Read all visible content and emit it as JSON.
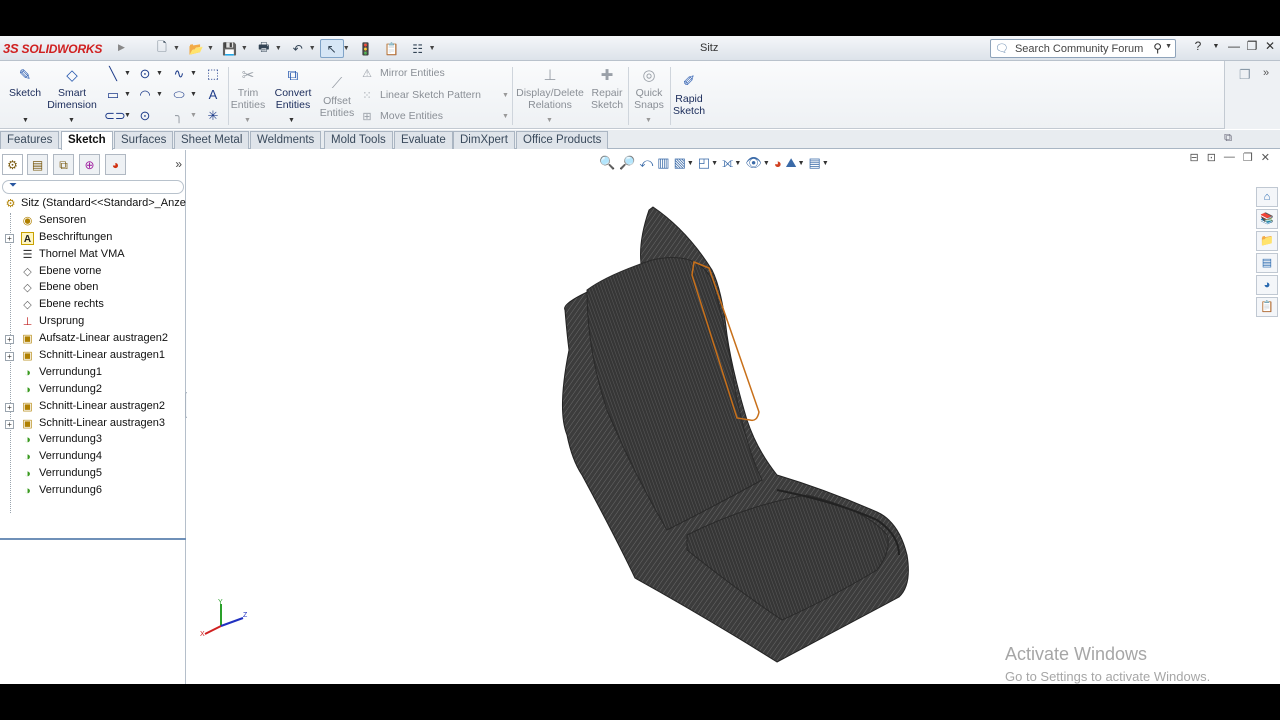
{
  "app": {
    "brand_prefix": "3S",
    "brand": "SOLIDWORKS",
    "document_title": "Sitz"
  },
  "search": {
    "placeholder": "Search Community Forum"
  },
  "commands": {
    "sketch": "Sketch",
    "smart_dimension": "Smart Dimension",
    "trim_entities": "Trim Entities",
    "convert_entities": "Convert Entities",
    "offset_entities": "Offset Entities",
    "mirror_entities": "Mirror Entities",
    "linear_sketch_pattern": "Linear Sketch Pattern",
    "move_entities": "Move Entities",
    "display_delete_relations": "Display/Delete Relations",
    "repair_sketch": "Repair Sketch",
    "quick_snaps": "Quick Snaps",
    "rapid_sketch": "Rapid Sketch"
  },
  "tabs": [
    {
      "label": "Features"
    },
    {
      "label": "Sketch",
      "active": true
    },
    {
      "label": "Surfaces"
    },
    {
      "label": "Sheet Metal"
    },
    {
      "label": "Weldments"
    },
    {
      "label": "Mold Tools"
    },
    {
      "label": "Evaluate"
    },
    {
      "label": "DimXpert"
    },
    {
      "label": "Office Products"
    }
  ],
  "tree": {
    "root": "Sitz  (Standard<<Standard>_Anze",
    "items": [
      {
        "label": "Sensoren",
        "icon": "sensor-icon",
        "expand": false
      },
      {
        "label": "Beschriftungen",
        "icon": "annotations-icon",
        "expand": true
      },
      {
        "label": "Thornel Mat VMA",
        "icon": "material-icon",
        "expand": false
      },
      {
        "label": "Ebene vorne",
        "icon": "plane-icon",
        "expand": false
      },
      {
        "label": "Ebene oben",
        "icon": "plane-icon",
        "expand": false
      },
      {
        "label": "Ebene rechts",
        "icon": "plane-icon",
        "expand": false
      },
      {
        "label": "Ursprung",
        "icon": "origin-icon",
        "expand": false
      },
      {
        "label": "Aufsatz-Linear austragen2",
        "icon": "extrude-boss-icon",
        "expand": true
      },
      {
        "label": "Schnitt-Linear austragen1",
        "icon": "extrude-cut-icon",
        "expand": true
      },
      {
        "label": "Verrundung1",
        "icon": "fillet-icon",
        "expand": false
      },
      {
        "label": "Verrundung2",
        "icon": "fillet-icon",
        "expand": false
      },
      {
        "label": "Schnitt-Linear austragen2",
        "icon": "extrude-cut-icon",
        "expand": true
      },
      {
        "label": "Schnitt-Linear austragen3",
        "icon": "extrude-cut-icon",
        "expand": true
      },
      {
        "label": "Verrundung3",
        "icon": "fillet-icon",
        "expand": false
      },
      {
        "label": "Verrundung4",
        "icon": "fillet-icon",
        "expand": false
      },
      {
        "label": "Verrundung5",
        "icon": "fillet-icon",
        "expand": false
      },
      {
        "label": "Verrundung6",
        "icon": "fillet-icon",
        "expand": false
      }
    ]
  },
  "watermark": {
    "line1": "Activate Windows",
    "line2": "Go to Settings to activate Windows."
  },
  "colors": {
    "brand_red": "#d02020",
    "model_dark": "#3a3a3a",
    "sketch_orange": "#c8701a",
    "selection_blue": "#6f90b8"
  }
}
